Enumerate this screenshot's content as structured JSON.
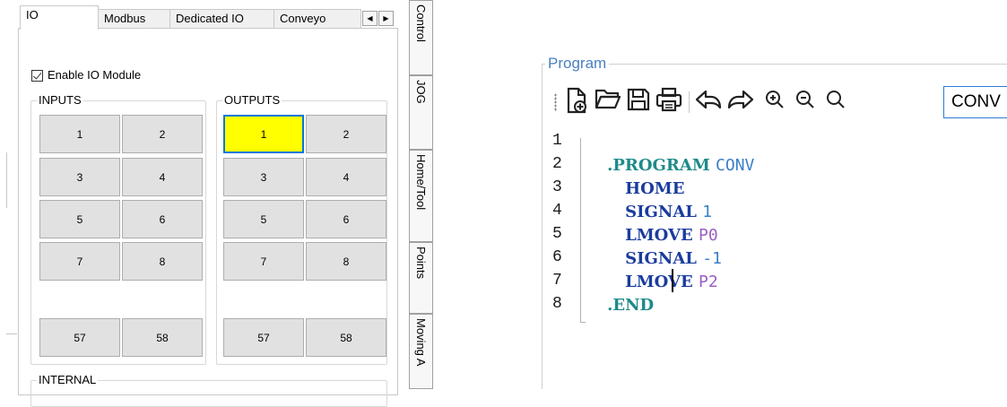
{
  "io_panel": {
    "tabs": [
      {
        "label": "IO",
        "active": true
      },
      {
        "label": "Modbus",
        "active": false
      },
      {
        "label": "Dedicated IO",
        "active": false
      },
      {
        "label": "Conveyo",
        "active": false
      }
    ],
    "scroll_left": "◀",
    "scroll_right": "▶",
    "enable_label": "Enable IO Module",
    "enable_checked": true,
    "inputs": {
      "label": "INPUTS",
      "buttons": [
        "1",
        "2",
        "3",
        "4",
        "5",
        "6",
        "7",
        "8",
        "57",
        "58"
      ]
    },
    "outputs": {
      "label": "OUTPUTS",
      "buttons": [
        "1",
        "2",
        "3",
        "4",
        "5",
        "6",
        "7",
        "8",
        "57",
        "58"
      ],
      "active_output": "1",
      "active_color": "#ffff00"
    },
    "internal_label": "INTERNAL"
  },
  "side_tabs": [
    "Control",
    "JOG",
    "Home/Tool",
    "Points",
    "Moving A"
  ],
  "program": {
    "group_title": "Program",
    "toolbar": {
      "icons": [
        "new-file-icon",
        "open-folder-icon",
        "save-icon",
        "print-icon",
        "undo-icon",
        "redo-icon",
        "zoom-in-icon",
        "zoom-out-icon",
        "zoom-reset-icon"
      ],
      "program_name": "CONV"
    },
    "line_numbers": [
      "1",
      "2",
      "3",
      "4",
      "5",
      "6",
      "7",
      "8"
    ],
    "code": [
      {
        "keyword": ".PROGRAM",
        "arg": "CONV"
      },
      {
        "keyword": "HOME",
        "arg": ""
      },
      {
        "keyword": "SIGNAL",
        "arg": "1"
      },
      {
        "keyword": "LMOVE",
        "arg": "P0"
      },
      {
        "keyword": "SIGNAL",
        "arg": "-1"
      },
      {
        "keyword": "LMOVE",
        "arg": "P2"
      },
      {
        "keyword": ".END",
        "arg": ""
      },
      {
        "keyword": "",
        "arg": ""
      }
    ]
  }
}
